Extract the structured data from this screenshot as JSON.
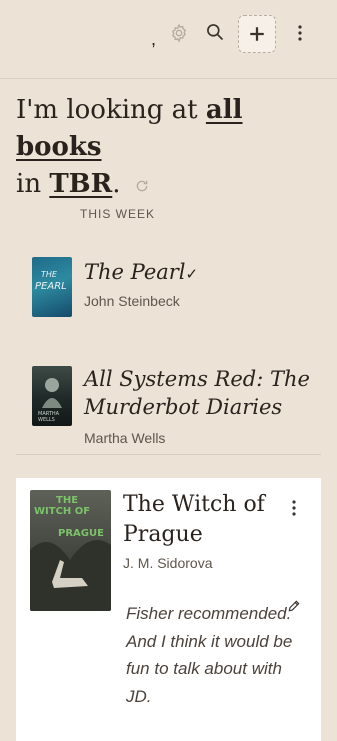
{
  "topbar": {
    "dot": ",",
    "icons": [
      "gear-icon",
      "search-icon",
      "plus-icon",
      "more-vertical-icon"
    ]
  },
  "heading": {
    "prefix": "I'm looking at ",
    "filter1": "all",
    "space": " ",
    "filter2": "books",
    "in": "in ",
    "shelf": "TBR",
    "period": "."
  },
  "section": {
    "label": "THIS WEEK"
  },
  "books": [
    {
      "title": "The Pearl",
      "check": "✓",
      "author": "John Steinbeck",
      "cover_text": "PEARL",
      "cover_top": "THE"
    },
    {
      "title": "All Systems Red: The Murderbot Diaries",
      "author": "Martha Wells",
      "cover_text": "MARTHA WELLS"
    },
    {
      "title": "The Witch of Prague",
      "author": "J. M. Sidorova",
      "note": "Fisher recommended. And I think it would be fun to talk about with JD.",
      "cover_line1": "THE",
      "cover_line2": "WITCH OF",
      "cover_line3": "PRAGUE"
    }
  ],
  "colors": {
    "background": "#ece2d6",
    "card": "#ffffff",
    "text": "#2a231d",
    "muted": "#5f554b"
  }
}
